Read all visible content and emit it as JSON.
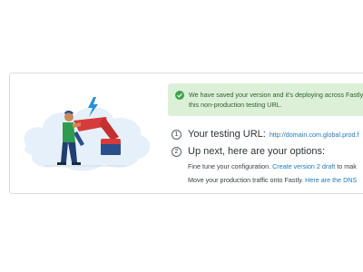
{
  "banner": {
    "line1": "We have saved your version and it's deploying across Fastly",
    "line2": "this non-production testing URL."
  },
  "step1": {
    "number": "1",
    "title": "Your testing URL:",
    "url": "http://domain.com.global.prod.f"
  },
  "step2": {
    "number": "2",
    "title": "Up next, here are your options:",
    "option1_text": "Fine tune your configuration.",
    "option1_link": "Create version 2 draft",
    "option1_after": " to mak",
    "option2_text": "Move your production traffic onto Fastly.",
    "option2_link": "Here are the DNS"
  },
  "colors": {
    "banner_bg": "#dcf0d8",
    "check": "#3fa34d",
    "link": "#1f78c1",
    "accent_red": "#d63b3b",
    "accent_blue": "#2a4f8a"
  }
}
